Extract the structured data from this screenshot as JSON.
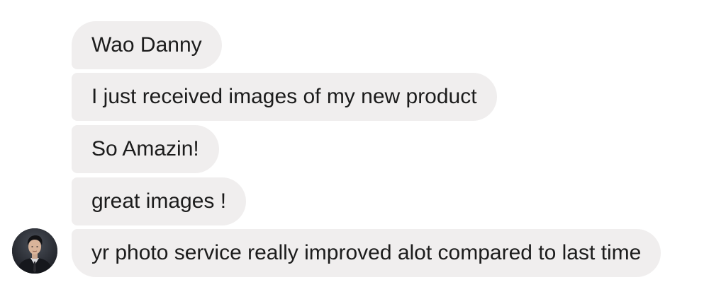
{
  "conversation": {
    "messages": [
      {
        "text": "Wao Danny"
      },
      {
        "text": "I just received images of my new product"
      },
      {
        "text": "So Amazin!"
      },
      {
        "text": "great images !"
      },
      {
        "text": "yr photo service really improved alot compared to last time"
      }
    ],
    "sender_avatar": {
      "icon": "user-avatar-photo"
    }
  },
  "colors": {
    "bubble_background": "#f0eeee",
    "text": "#1c1c1c",
    "background": "#ffffff"
  }
}
